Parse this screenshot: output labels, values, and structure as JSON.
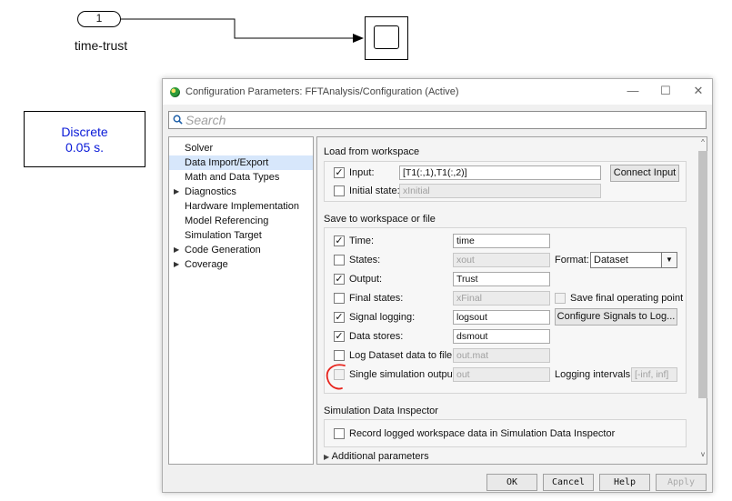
{
  "canvas": {
    "inport_number": "1",
    "inport_label": "time-trust",
    "discrete_block": {
      "line1": "Discrete",
      "line2": "0.05 s."
    }
  },
  "window": {
    "title": "Configuration Parameters: FFTAnalysis/Configuration (Active)",
    "minimize": "—",
    "maximize": "☐",
    "close": "✕"
  },
  "search": {
    "placeholder": "Search"
  },
  "tree": [
    {
      "label": "Solver",
      "arrow": ""
    },
    {
      "label": "Data Import/Export",
      "arrow": "",
      "selected": true
    },
    {
      "label": "Math and Data Types",
      "arrow": ""
    },
    {
      "label": "Diagnostics",
      "arrow": "▶"
    },
    {
      "label": "Hardware Implementation",
      "arrow": ""
    },
    {
      "label": "Model Referencing",
      "arrow": ""
    },
    {
      "label": "Simulation Target",
      "arrow": ""
    },
    {
      "label": "Code Generation",
      "arrow": "▶"
    },
    {
      "label": "Coverage",
      "arrow": "▶"
    }
  ],
  "load": {
    "title": "Load from workspace",
    "input_label": "Input:",
    "input_value": "[T1(:,1),T1(:,2)]",
    "connect_input": "Connect Input",
    "initial_state_label": "Initial state:",
    "initial_state_value": "xInitial"
  },
  "save": {
    "title": "Save to workspace or file",
    "time_label": "Time:",
    "time_value": "time",
    "states_label": "States:",
    "states_value": "xout",
    "format_label": "Format:",
    "format_value": "Dataset",
    "output_label": "Output:",
    "output_value": "Trust",
    "final_states_label": "Final states:",
    "final_states_value": "xFinal",
    "save_final_label": "Save final operating point",
    "signal_logging_label": "Signal logging:",
    "signal_logging_value": "logsout",
    "configure_signals": "Configure Signals to Log...",
    "data_stores_label": "Data stores:",
    "data_stores_value": "dsmout",
    "log_dataset_label": "Log Dataset data to file:",
    "log_dataset_value": "out.mat",
    "single_sim_label": "Single simulation output:",
    "single_sim_value": "out",
    "logging_intervals_label": "Logging intervals:",
    "logging_intervals_value": "[-inf, inf]"
  },
  "sdi": {
    "title": "Simulation Data Inspector",
    "record_label": "Record logged workspace data in Simulation Data Inspector"
  },
  "additional": {
    "label": "Additional parameters",
    "arrow": "▶"
  },
  "buttons": {
    "ok": "OK",
    "cancel": "Cancel",
    "help": "Help",
    "apply": "Apply"
  },
  "check": "✓",
  "colors": {
    "discrete_text": "#0a1ad8",
    "annotation_red": "#e8241d",
    "selection": "#d7e7fb"
  }
}
